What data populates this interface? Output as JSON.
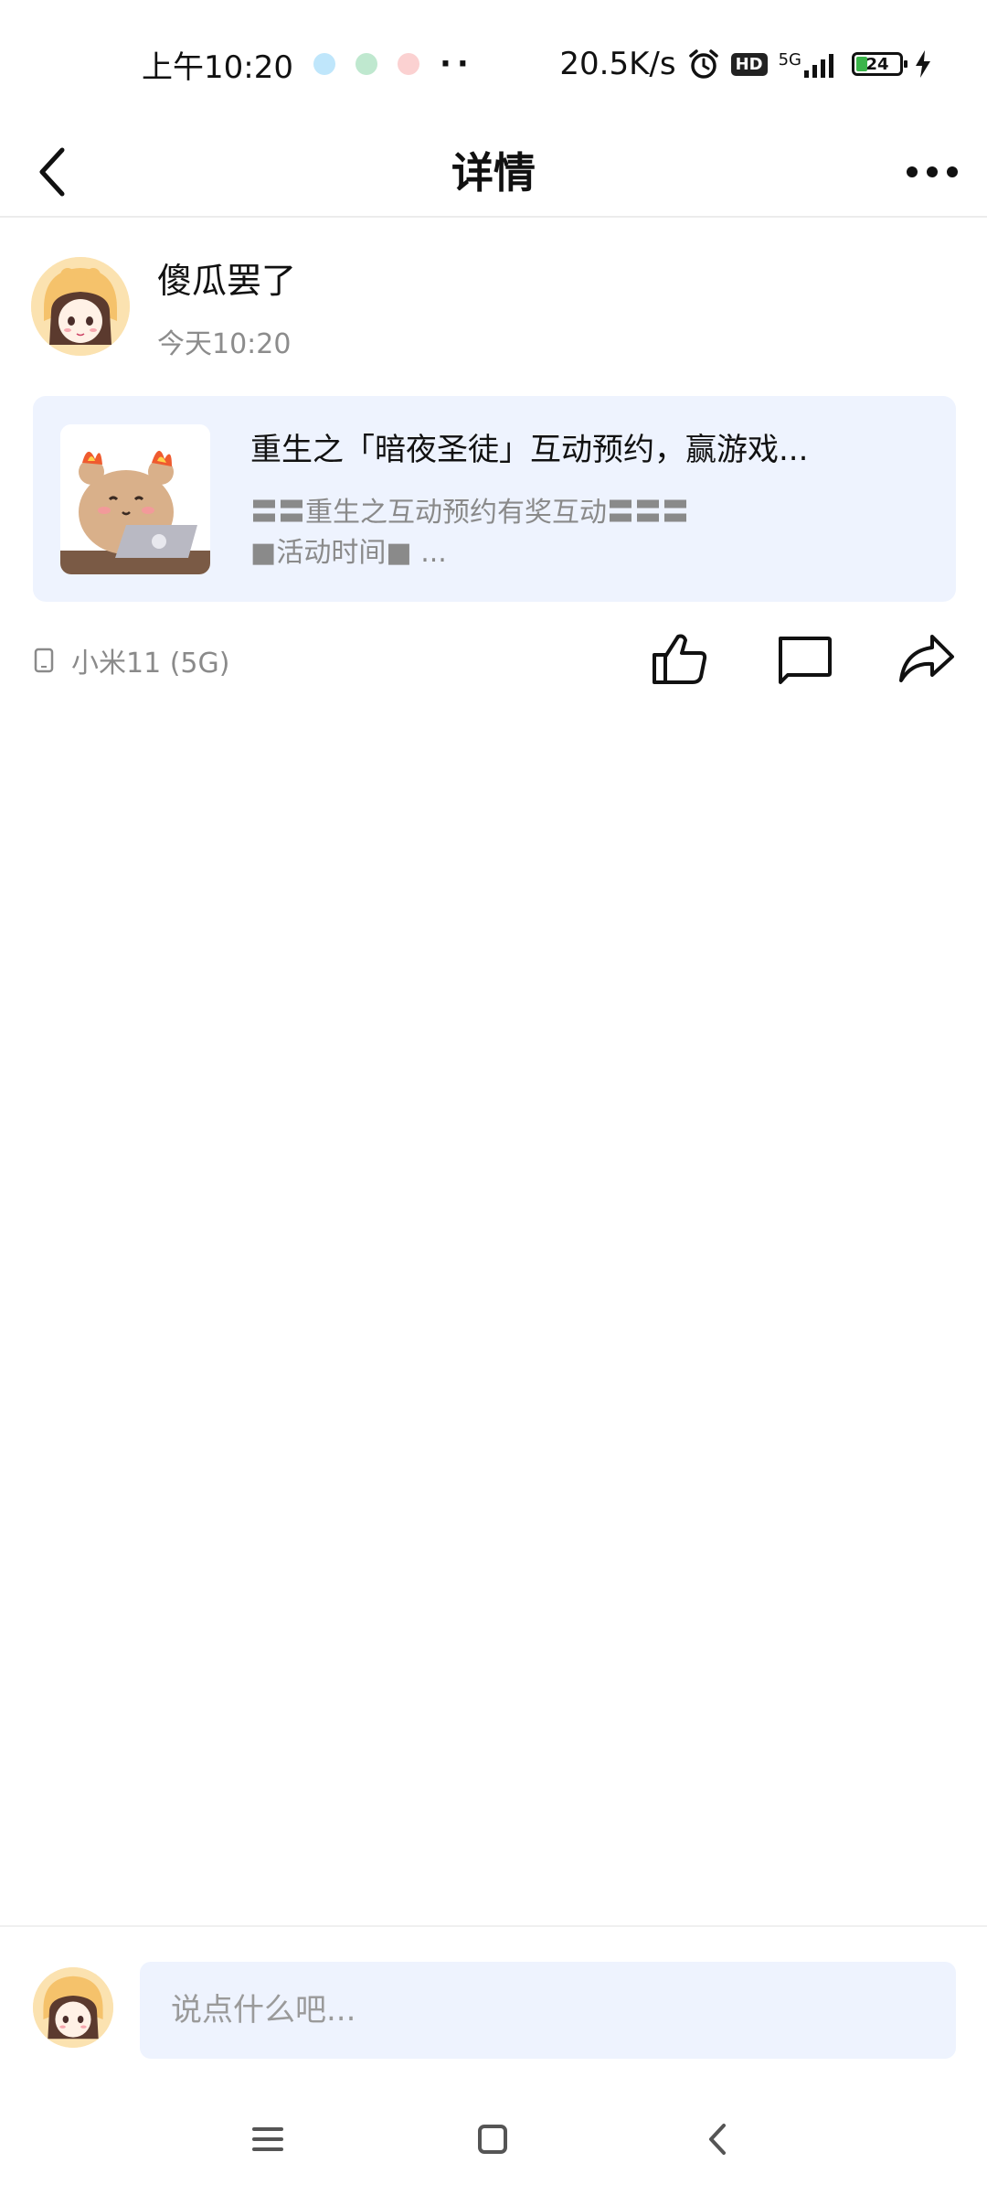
{
  "status_bar": {
    "time": "上午10:20",
    "dots": "··",
    "net_speed": "20.5K/s",
    "hd_badge": "HD",
    "signal": "5G",
    "battery": "24",
    "notification_colors": [
      "#bfe6fb",
      "#bfe8cf",
      "#fbd1d1"
    ]
  },
  "nav": {
    "title": "详情",
    "back_icon": "chevron-left-icon",
    "more_icon": "more-dots-icon"
  },
  "post": {
    "author_name": "傻瓜罢了",
    "time": "今天10:20",
    "card": {
      "title": "重生之「暗夜圣徒」互动预约，赢游戏...",
      "desc_line1": "〓〓重生之互动预约有奖互动〓〓〓",
      "desc_line2": "■活动时间■ ..."
    },
    "device": "小米11 (5G)"
  },
  "comment_bar": {
    "placeholder": "说点什么吧..."
  },
  "colors": {
    "card_bg": "#eef3fe",
    "secondary_text": "#8a8a8a",
    "battery_fill": "#3bb54a"
  }
}
